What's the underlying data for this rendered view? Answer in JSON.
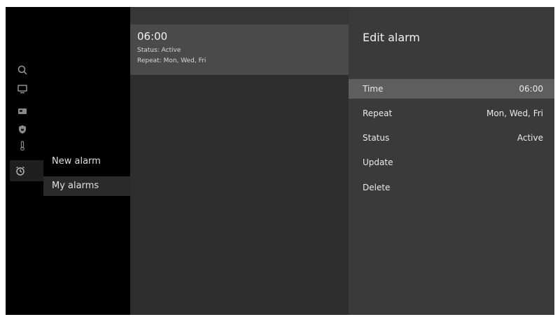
{
  "sidebar": {
    "icons": [
      "search-icon",
      "tv-icon",
      "radio-icon",
      "shield-icon",
      "thermometer-icon",
      "alarm-clock-icon"
    ],
    "menu": [
      {
        "label": "New alarm"
      },
      {
        "label": "My alarms"
      }
    ]
  },
  "alarms": [
    {
      "time": "06:00",
      "status": "Status: Active",
      "repeat": "Repeat: Mon, Wed, Fri"
    }
  ],
  "edit": {
    "title": "Edit alarm",
    "options": [
      {
        "label": "Time",
        "value": "06:00"
      },
      {
        "label": "Repeat",
        "value": "Mon, Wed, Fri"
      },
      {
        "label": "Status",
        "value": "Active"
      },
      {
        "label": "Update",
        "value": ""
      },
      {
        "label": "Delete",
        "value": ""
      }
    ]
  }
}
